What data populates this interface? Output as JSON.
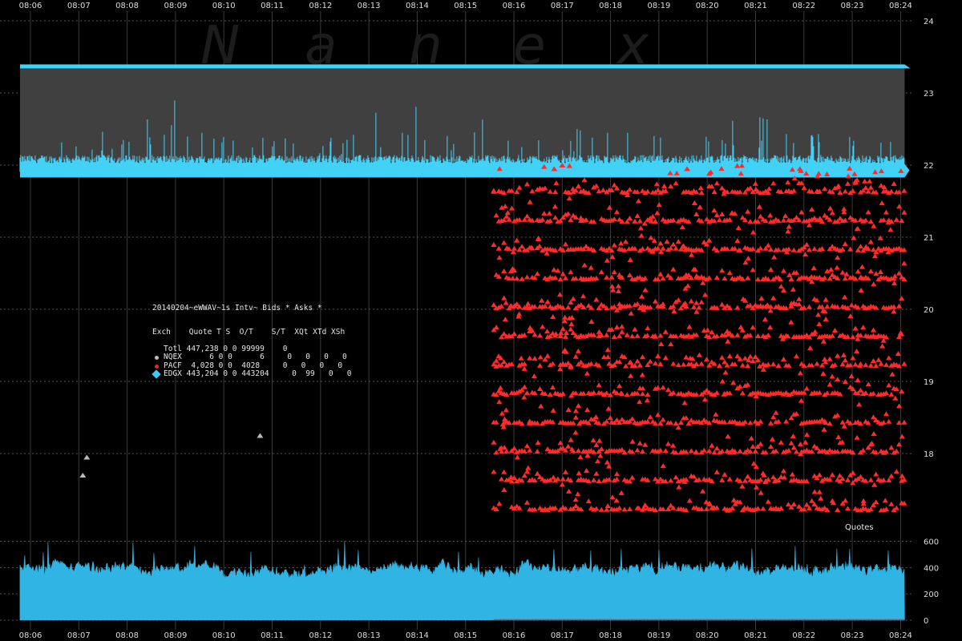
{
  "watermark": [
    "N",
    "a",
    "n",
    "e",
    "x"
  ],
  "legend": {
    "header1": "20140204~eWWAV~1s Intv~ Bids * Asks *",
    "header2": "Exch    Quote T S  O/T    S/T  XQt XTd XSh",
    "rows": [
      {
        "text": "Totl 447,238 0 0 99999    0",
        "marker": "none",
        "color": ""
      },
      {
        "text": "NQEX      6 0 0      6     0   0   0   0",
        "marker": "dot",
        "color": "#bbbbbb"
      },
      {
        "text": "PACF  4,028 0 0  4028     0   0   0   0",
        "marker": "dot",
        "color": "#ee2222"
      },
      {
        "text": "EDGX 443,204 0 0 443204     0  99   0   0",
        "marker": "diamond",
        "color": "#3fc8f0"
      }
    ]
  },
  "quotes_label": "Quotes",
  "colors": {
    "edgx": "#42d2f8",
    "pacf": "#ff2a2a",
    "nqex": "#bbbbbb",
    "band_fill": "#404040",
    "grid": "#3a3a3a",
    "volume": "#2fb4e4"
  },
  "chart_data": [
    {
      "type": "scatter",
      "title": "",
      "x_ticks": [
        "08:06",
        "08:07",
        "08:08",
        "08:09",
        "08:10",
        "08:11",
        "08:12",
        "08:13",
        "08:14",
        "08:15",
        "08:16",
        "08:17",
        "08:18",
        "08:19",
        "08:20",
        "08:21",
        "08:22",
        "08:23",
        "08:24"
      ],
      "xlim": [
        "08:05:47",
        "08:24:15"
      ],
      "y_ticks": [
        18,
        19,
        20,
        21,
        22,
        23,
        24
      ],
      "ylim": [
        17.0,
        24.2
      ],
      "grid": true,
      "series": [
        {
          "name": "EDGX",
          "kind": "band",
          "ask": 23.34,
          "bid_ceiling": 22.05,
          "bid": 21.95,
          "x_start": "08:05:47",
          "x_end": "08:24:05"
        },
        {
          "name": "PACF",
          "kind": "scatter",
          "x_start": "08:15:35",
          "x_end": "08:24:05",
          "y_levels": [
            21.65,
            21.25,
            20.85,
            20.45,
            20.05,
            19.65,
            19.25,
            18.85,
            18.45,
            18.05,
            17.65,
            17.25
          ],
          "y_min": 17.2,
          "y_max": 22.0
        },
        {
          "name": "NQEX",
          "kind": "scatter",
          "points": [
            {
              "x": "08:07:05",
              "y": 17.7
            },
            {
              "x": "08:07:10",
              "y": 17.95
            },
            {
              "x": "08:10:45",
              "y": 18.25
            }
          ]
        }
      ]
    },
    {
      "type": "area",
      "title": "Quotes",
      "x_ticks": [
        "08:06",
        "08:07",
        "08:08",
        "08:09",
        "08:10",
        "08:11",
        "08:12",
        "08:13",
        "08:14",
        "08:15",
        "08:16",
        "08:17",
        "08:18",
        "08:19",
        "08:20",
        "08:21",
        "08:22",
        "08:23",
        "08:24"
      ],
      "y_ticks": [
        0,
        200,
        400,
        600
      ],
      "ylim": [
        0,
        650
      ],
      "series": [
        {
          "name": "EDGX",
          "baseline": 380,
          "range": [
            300,
            600
          ]
        },
        {
          "name": "PACF",
          "baseline": 8,
          "x_start": "08:15:35"
        }
      ]
    }
  ]
}
